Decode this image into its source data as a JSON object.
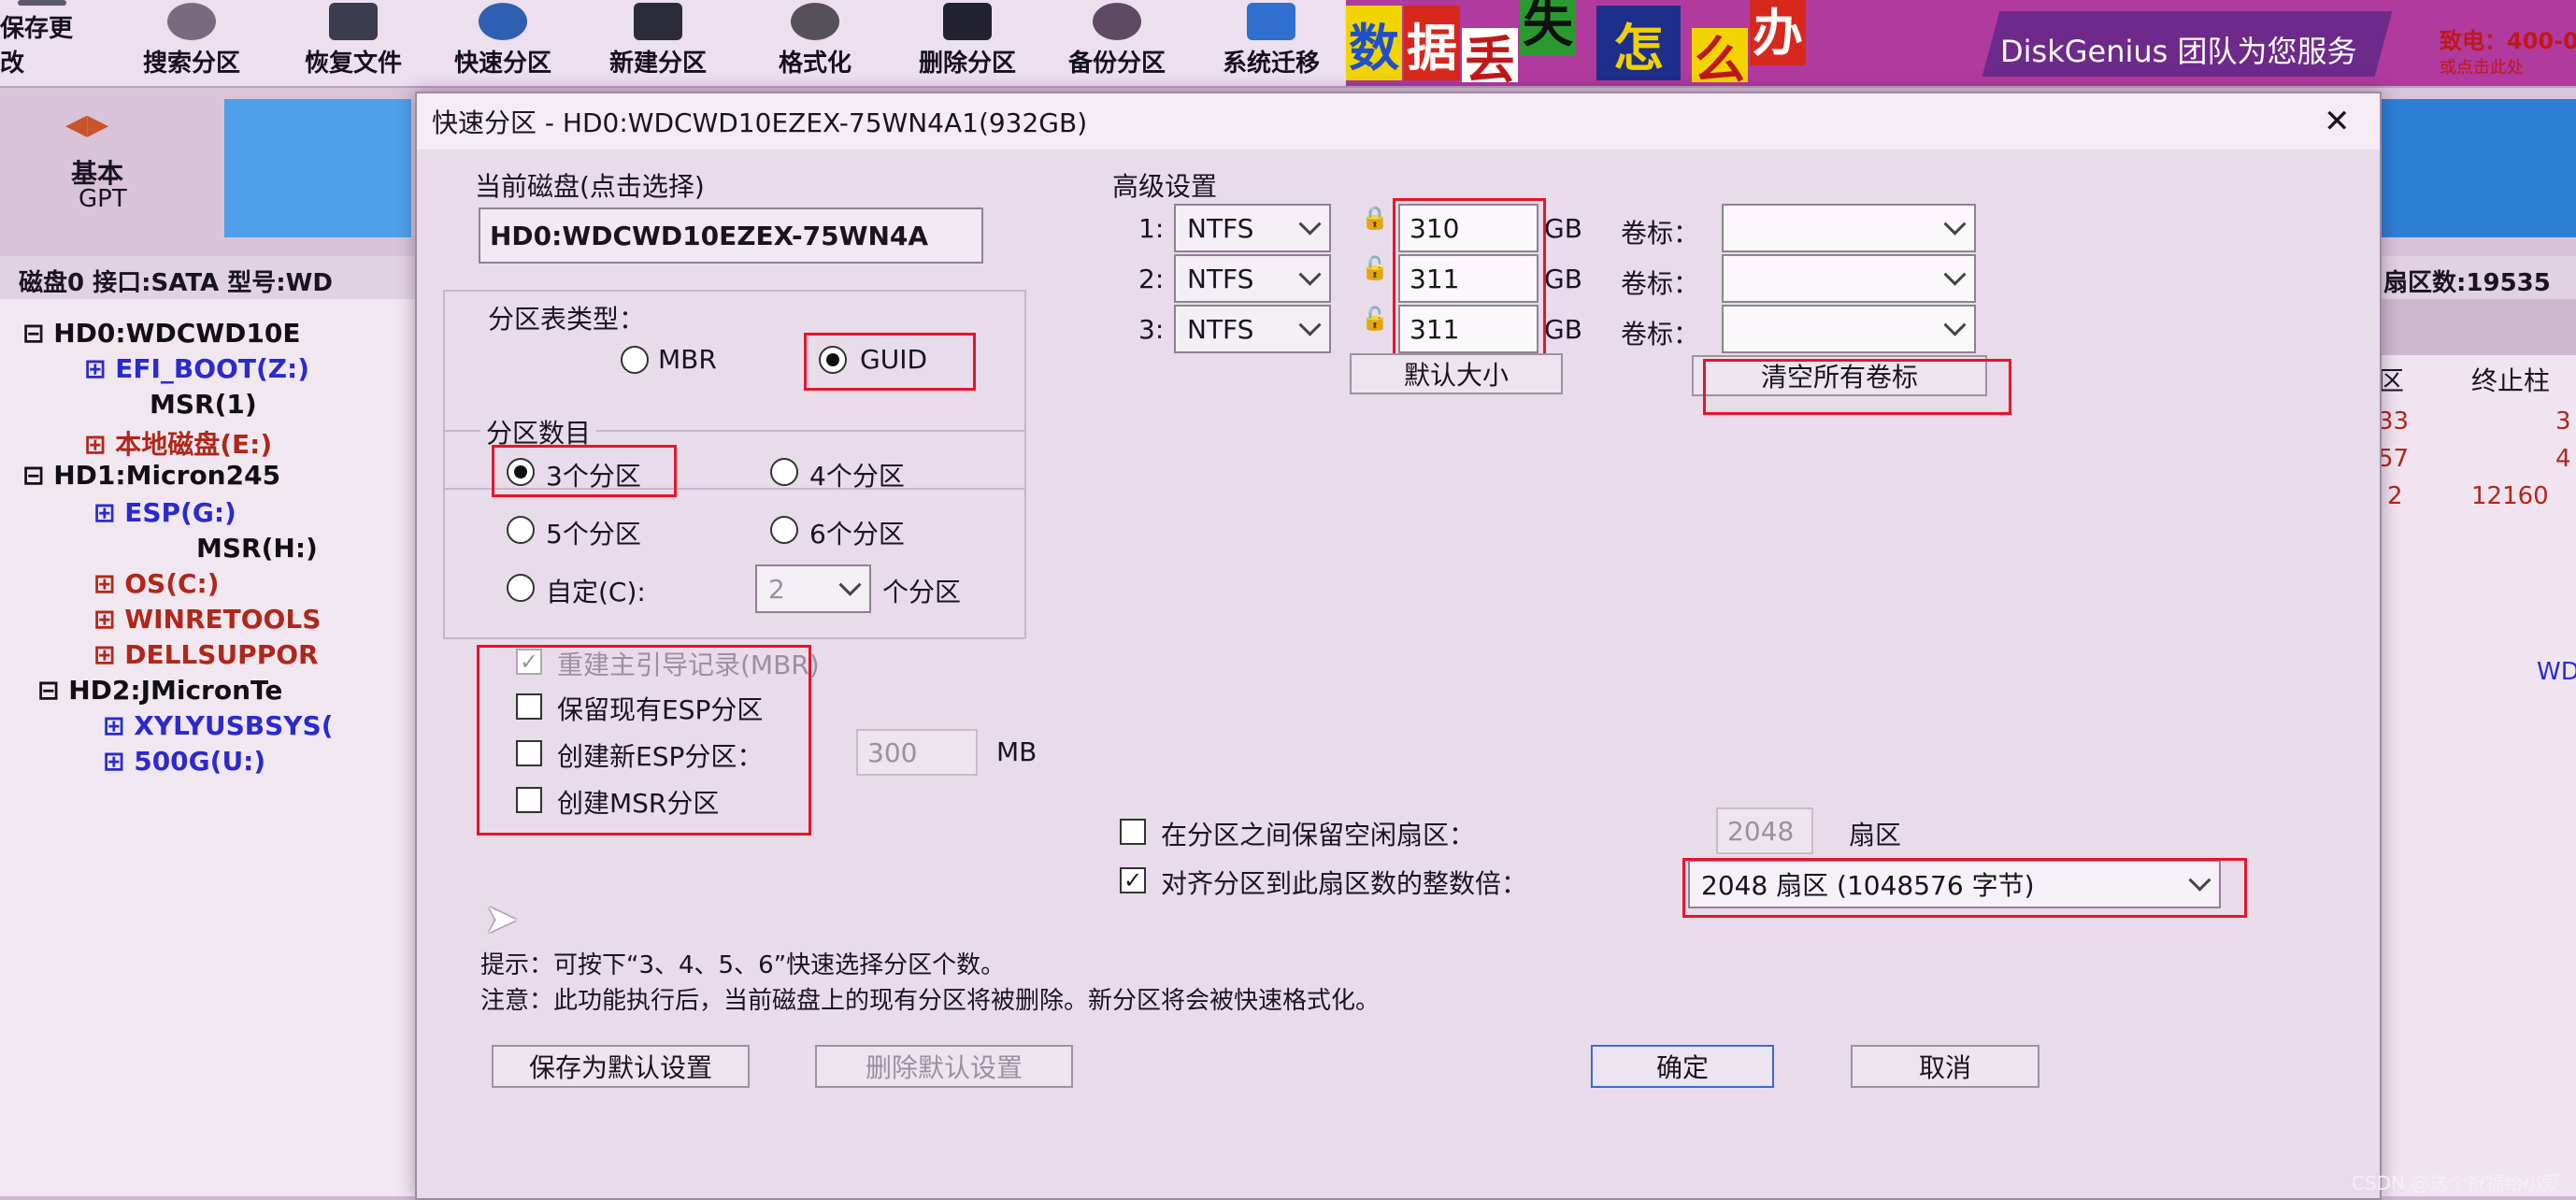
{
  "toolbar": {
    "buttons": [
      "保存更改",
      "搜索分区",
      "恢复文件",
      "快速分区",
      "新建分区",
      "格式化",
      "删除分区",
      "备份分区",
      "系统迁移"
    ],
    "banner_chars": [
      "数",
      "据",
      "丢",
      "失",
      "怎",
      "么",
      "办",
      "!"
    ],
    "banner_text": "DiskGenius 团队为您服务",
    "banner_phone": "致电：400-0",
    "banner_sub": "或点击此处"
  },
  "disk_map": {
    "nav_label": "基本",
    "nav_sub": "GPT"
  },
  "status_line": {
    "left": "磁盘0 接口:SATA  型号:WD",
    "right": "扇区数:19535"
  },
  "tree": {
    "items": [
      {
        "label": "HD0:WDCWD10E",
        "color": "#111111"
      },
      {
        "label": "EFI_BOOT(Z:)",
        "color": "#2a2acf"
      },
      {
        "label": "MSR(1)",
        "color": "#111111"
      },
      {
        "label": "本地磁盘(E:)",
        "color": "#b0271a"
      },
      {
        "label": "HD1:Micron245",
        "color": "#111111"
      },
      {
        "label": "ESP(G:)",
        "color": "#2a2acf"
      },
      {
        "label": "MSR(H:)",
        "color": "#111111"
      },
      {
        "label": "OS(C:)",
        "color": "#b0271a"
      },
      {
        "label": "WINRETOOLS",
        "color": "#b0271a"
      },
      {
        "label": "DELLSUPPOR",
        "color": "#b0271a"
      },
      {
        "label": "HD2:JMicronTe",
        "color": "#111111"
      },
      {
        "label": "XYLYUSBSYS(",
        "color": "#2a2acf"
      },
      {
        "label": "500G(U:)",
        "color": "#2a2acf"
      }
    ]
  },
  "right_table": {
    "headers": [
      "区",
      "终止柱"
    ],
    "rows": [
      [
        "33",
        "3"
      ],
      [
        "57",
        "4"
      ],
      [
        "2",
        "12160"
      ]
    ],
    "extra": "WD"
  },
  "dialog": {
    "title": "快速分区 - HD0:WDCWD10EZEX-75WN4A1(932GB)",
    "close": "✕",
    "current_disk_label": "当前磁盘(点击选择)",
    "current_disk_value": "HD0:WDCWD10EZEX-75WN4A",
    "table_type_label": "分区表类型：",
    "mbr": "MBR",
    "guid": "GUID",
    "count_label": "分区数目",
    "count_options": [
      "3个分区",
      "4个分区",
      "5个分区",
      "6个分区"
    ],
    "custom_label": "自定(C):",
    "custom_value": "2",
    "custom_unit": "个分区",
    "rebuild_mbr": "重建主引导记录(MBR)",
    "keep_esp": "保留现有ESP分区",
    "create_esp": "创建新ESP分区：",
    "esp_size": "300",
    "esp_unit": "MB",
    "create_msr": "创建MSR分区",
    "advanced_label": "高级设置",
    "partitions": [
      {
        "index": "1:",
        "fs": "NTFS",
        "size": "310",
        "unit": "GB",
        "vol_label": "卷标："
      },
      {
        "index": "2:",
        "fs": "NTFS",
        "size": "311",
        "unit": "GB",
        "vol_label": "卷标："
      },
      {
        "index": "3:",
        "fs": "NTFS",
        "size": "311",
        "unit": "GB",
        "vol_label": "卷标："
      }
    ],
    "default_size": "默认大小",
    "clear_labels": "清空所有卷标",
    "keep_free_label": "在分区之间保留空闲扇区：",
    "keep_free_value": "2048",
    "keep_free_unit": "扇区",
    "align_label": "对齐分区到此扇区数的整数倍：",
    "align_value": "2048 扇区 (1048576 字节)",
    "hint": "提示：可按下“3、4、5、6”快速选择分区个数。",
    "note": "注意：此功能执行后，当前磁盘上的现有分区将被删除。新分区将会被快速格式化。",
    "save_default": "保存为默认设置",
    "delete_default": "删除默认设置",
    "ok": "确定",
    "cancel": "取消"
  },
  "watermark": "CSDN @送个祝福给小爱"
}
